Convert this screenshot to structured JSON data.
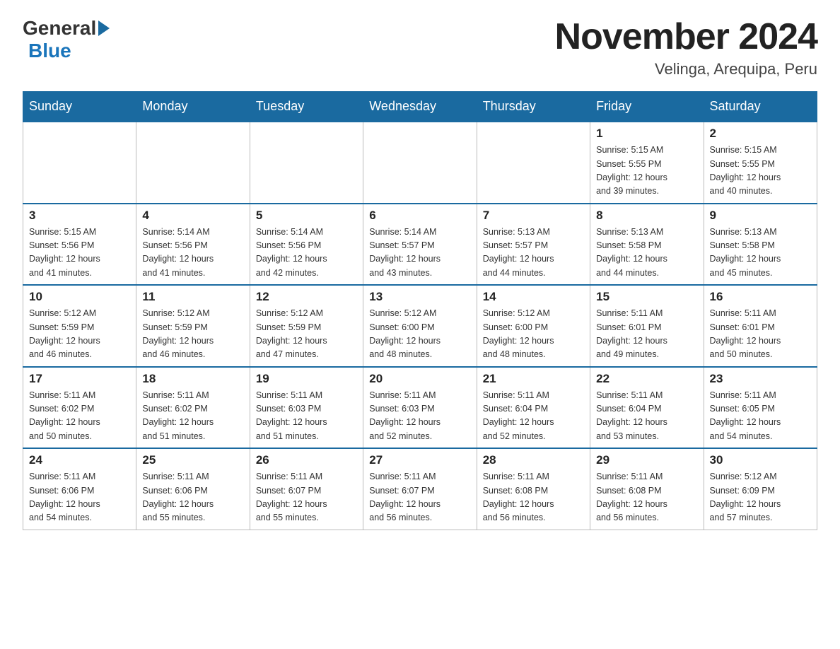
{
  "logo": {
    "general": "General",
    "blue": "Blue"
  },
  "title": "November 2024",
  "subtitle": "Velinga, Arequipa, Peru",
  "days_of_week": [
    "Sunday",
    "Monday",
    "Tuesday",
    "Wednesday",
    "Thursday",
    "Friday",
    "Saturday"
  ],
  "weeks": [
    [
      {
        "day": "",
        "info": ""
      },
      {
        "day": "",
        "info": ""
      },
      {
        "day": "",
        "info": ""
      },
      {
        "day": "",
        "info": ""
      },
      {
        "day": "",
        "info": ""
      },
      {
        "day": "1",
        "info": "Sunrise: 5:15 AM\nSunset: 5:55 PM\nDaylight: 12 hours\nand 39 minutes."
      },
      {
        "day": "2",
        "info": "Sunrise: 5:15 AM\nSunset: 5:55 PM\nDaylight: 12 hours\nand 40 minutes."
      }
    ],
    [
      {
        "day": "3",
        "info": "Sunrise: 5:15 AM\nSunset: 5:56 PM\nDaylight: 12 hours\nand 41 minutes."
      },
      {
        "day": "4",
        "info": "Sunrise: 5:14 AM\nSunset: 5:56 PM\nDaylight: 12 hours\nand 41 minutes."
      },
      {
        "day": "5",
        "info": "Sunrise: 5:14 AM\nSunset: 5:56 PM\nDaylight: 12 hours\nand 42 minutes."
      },
      {
        "day": "6",
        "info": "Sunrise: 5:14 AM\nSunset: 5:57 PM\nDaylight: 12 hours\nand 43 minutes."
      },
      {
        "day": "7",
        "info": "Sunrise: 5:13 AM\nSunset: 5:57 PM\nDaylight: 12 hours\nand 44 minutes."
      },
      {
        "day": "8",
        "info": "Sunrise: 5:13 AM\nSunset: 5:58 PM\nDaylight: 12 hours\nand 44 minutes."
      },
      {
        "day": "9",
        "info": "Sunrise: 5:13 AM\nSunset: 5:58 PM\nDaylight: 12 hours\nand 45 minutes."
      }
    ],
    [
      {
        "day": "10",
        "info": "Sunrise: 5:12 AM\nSunset: 5:59 PM\nDaylight: 12 hours\nand 46 minutes."
      },
      {
        "day": "11",
        "info": "Sunrise: 5:12 AM\nSunset: 5:59 PM\nDaylight: 12 hours\nand 46 minutes."
      },
      {
        "day": "12",
        "info": "Sunrise: 5:12 AM\nSunset: 5:59 PM\nDaylight: 12 hours\nand 47 minutes."
      },
      {
        "day": "13",
        "info": "Sunrise: 5:12 AM\nSunset: 6:00 PM\nDaylight: 12 hours\nand 48 minutes."
      },
      {
        "day": "14",
        "info": "Sunrise: 5:12 AM\nSunset: 6:00 PM\nDaylight: 12 hours\nand 48 minutes."
      },
      {
        "day": "15",
        "info": "Sunrise: 5:11 AM\nSunset: 6:01 PM\nDaylight: 12 hours\nand 49 minutes."
      },
      {
        "day": "16",
        "info": "Sunrise: 5:11 AM\nSunset: 6:01 PM\nDaylight: 12 hours\nand 50 minutes."
      }
    ],
    [
      {
        "day": "17",
        "info": "Sunrise: 5:11 AM\nSunset: 6:02 PM\nDaylight: 12 hours\nand 50 minutes."
      },
      {
        "day": "18",
        "info": "Sunrise: 5:11 AM\nSunset: 6:02 PM\nDaylight: 12 hours\nand 51 minutes."
      },
      {
        "day": "19",
        "info": "Sunrise: 5:11 AM\nSunset: 6:03 PM\nDaylight: 12 hours\nand 51 minutes."
      },
      {
        "day": "20",
        "info": "Sunrise: 5:11 AM\nSunset: 6:03 PM\nDaylight: 12 hours\nand 52 minutes."
      },
      {
        "day": "21",
        "info": "Sunrise: 5:11 AM\nSunset: 6:04 PM\nDaylight: 12 hours\nand 52 minutes."
      },
      {
        "day": "22",
        "info": "Sunrise: 5:11 AM\nSunset: 6:04 PM\nDaylight: 12 hours\nand 53 minutes."
      },
      {
        "day": "23",
        "info": "Sunrise: 5:11 AM\nSunset: 6:05 PM\nDaylight: 12 hours\nand 54 minutes."
      }
    ],
    [
      {
        "day": "24",
        "info": "Sunrise: 5:11 AM\nSunset: 6:06 PM\nDaylight: 12 hours\nand 54 minutes."
      },
      {
        "day": "25",
        "info": "Sunrise: 5:11 AM\nSunset: 6:06 PM\nDaylight: 12 hours\nand 55 minutes."
      },
      {
        "day": "26",
        "info": "Sunrise: 5:11 AM\nSunset: 6:07 PM\nDaylight: 12 hours\nand 55 minutes."
      },
      {
        "day": "27",
        "info": "Sunrise: 5:11 AM\nSunset: 6:07 PM\nDaylight: 12 hours\nand 56 minutes."
      },
      {
        "day": "28",
        "info": "Sunrise: 5:11 AM\nSunset: 6:08 PM\nDaylight: 12 hours\nand 56 minutes."
      },
      {
        "day": "29",
        "info": "Sunrise: 5:11 AM\nSunset: 6:08 PM\nDaylight: 12 hours\nand 56 minutes."
      },
      {
        "day": "30",
        "info": "Sunrise: 5:12 AM\nSunset: 6:09 PM\nDaylight: 12 hours\nand 57 minutes."
      }
    ]
  ],
  "colors": {
    "header_bg": "#1a6aa0",
    "header_text": "#ffffff",
    "border": "#1a6aa0",
    "day_number": "#222222",
    "day_info": "#333333"
  }
}
